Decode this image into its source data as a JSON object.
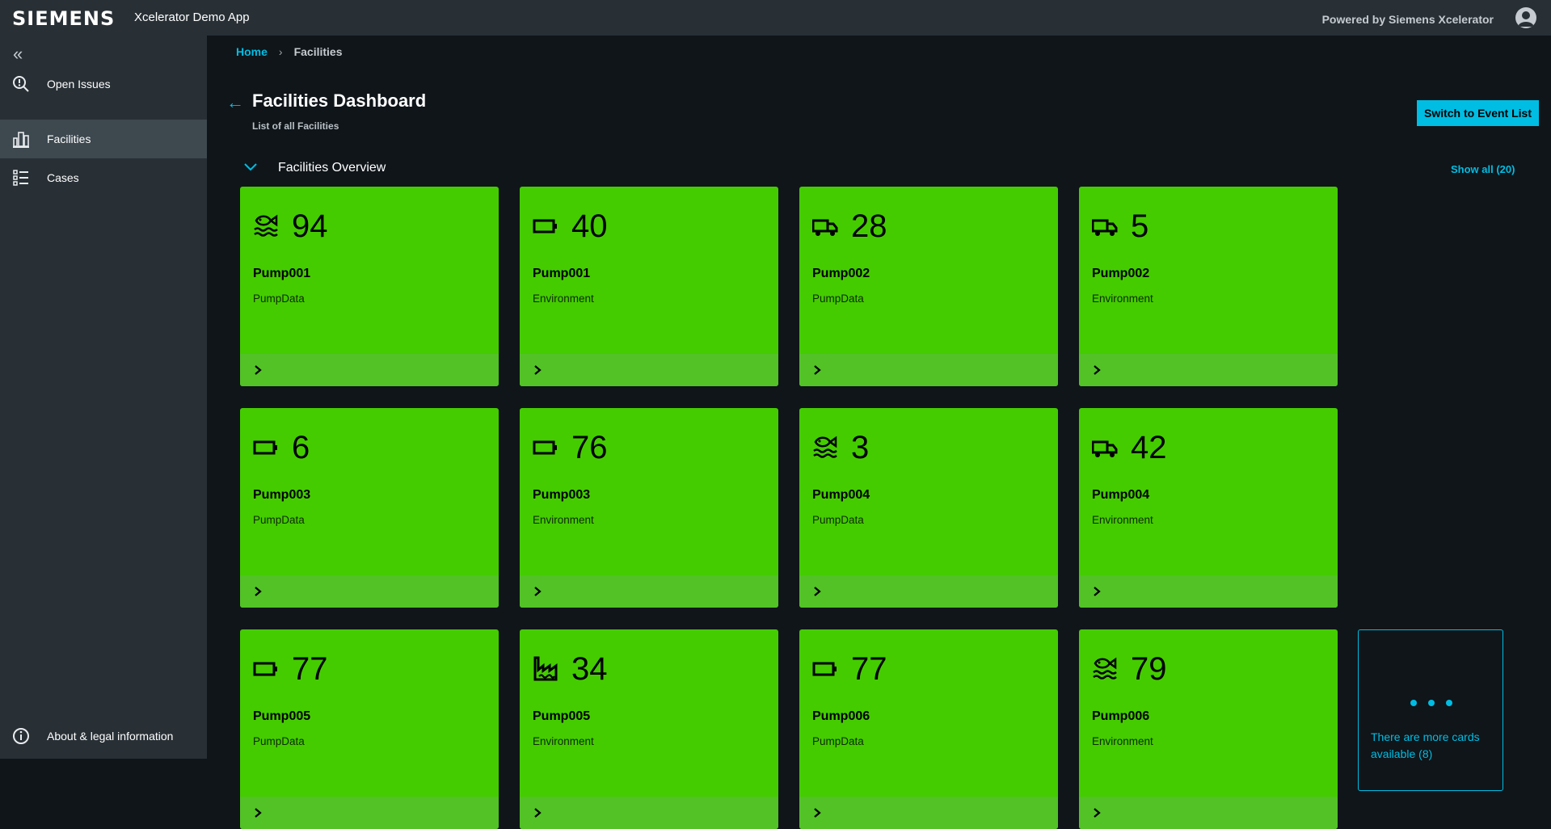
{
  "header": {
    "logo": "SIEMENS",
    "app_name": "Xcelerator Demo App",
    "powered_by": "Powered by Siemens Xcelerator"
  },
  "sidebar": {
    "items": [
      {
        "label": "Open Issues",
        "icon": "search-alert-icon",
        "active": false
      },
      {
        "label": "Facilities",
        "icon": "building-icon",
        "active": true
      },
      {
        "label": "Cases",
        "icon": "list-icon",
        "active": false
      }
    ],
    "footer_item": {
      "label": "About & legal information",
      "icon": "info-icon"
    }
  },
  "breadcrumb": {
    "home": "Home",
    "separator": "›",
    "current": "Facilities"
  },
  "page": {
    "title": "Facilities Dashboard",
    "subtitle": "List of all Facilities",
    "switch_button": "Switch to Event List"
  },
  "section": {
    "title": "Facilities Overview",
    "show_all": "Show all (20)"
  },
  "colors": {
    "accent": "#00bde3",
    "card_ok": "#44cc00",
    "card_footer": "#52c227"
  },
  "cards": [
    {
      "value": "94",
      "name": "Pump001",
      "type": "PumpData",
      "icon": "fish-water-icon"
    },
    {
      "value": "40",
      "name": "Pump001",
      "type": "Environment",
      "icon": "battery-icon"
    },
    {
      "value": "28",
      "name": "Pump002",
      "type": "PumpData",
      "icon": "truck-icon"
    },
    {
      "value": "5",
      "name": "Pump002",
      "type": "Environment",
      "icon": "truck-icon"
    },
    {
      "value": "6",
      "name": "Pump003",
      "type": "PumpData",
      "icon": "battery-icon"
    },
    {
      "value": "76",
      "name": "Pump003",
      "type": "Environment",
      "icon": "battery-icon"
    },
    {
      "value": "3",
      "name": "Pump004",
      "type": "PumpData",
      "icon": "fish-water-icon"
    },
    {
      "value": "42",
      "name": "Pump004",
      "type": "Environment",
      "icon": "truck-icon"
    },
    {
      "value": "77",
      "name": "Pump005",
      "type": "PumpData",
      "icon": "battery-icon"
    },
    {
      "value": "34",
      "name": "Pump005",
      "type": "Environment",
      "icon": "factory-water-icon"
    },
    {
      "value": "77",
      "name": "Pump006",
      "type": "PumpData",
      "icon": "battery-icon"
    },
    {
      "value": "79",
      "name": "Pump006",
      "type": "Environment",
      "icon": "fish-water-icon"
    }
  ],
  "more_card": {
    "text": "There are more cards available (8)"
  }
}
